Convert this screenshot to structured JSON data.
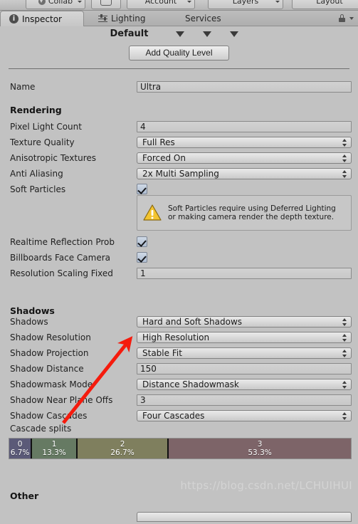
{
  "toolbar": {
    "collab_label": "Collab",
    "cloud_icon": "cloud-button-icon",
    "account_label": "Account",
    "layers_label": "Layers",
    "layout_label": "Layout"
  },
  "tabs": {
    "inspector": "Inspector",
    "lighting": "Lighting",
    "services": "Services",
    "lock_icon": "lock-icon"
  },
  "header": {
    "title": "Default",
    "dropdown_count": 3
  },
  "actions": {
    "add_quality_level": "Add Quality Level"
  },
  "name_row": {
    "label": "Name",
    "value": "Ultra"
  },
  "rendering": {
    "title": "Rendering",
    "rows": [
      {
        "label": "Pixel Light Count",
        "value": "4",
        "type": "text"
      },
      {
        "label": "Texture Quality",
        "value": "Full Res",
        "type": "popup"
      },
      {
        "label": "Anisotropic Textures",
        "value": "Forced On",
        "type": "popup"
      },
      {
        "label": "Anti Aliasing",
        "value": "2x Multi Sampling",
        "type": "popup"
      },
      {
        "label": "Soft Particles",
        "value": "checked",
        "type": "checkbox"
      }
    ],
    "warning": {
      "icon": "warning-triangle-icon",
      "text": "Soft Particles require using Deferred Lighting or making camera render the depth texture."
    },
    "rows_after_warning": [
      {
        "label": "Realtime Reflection Prob",
        "value": "checked",
        "type": "checkbox"
      },
      {
        "label": "Billboards Face Camera",
        "value": "checked",
        "type": "checkbox"
      },
      {
        "label": "Resolution Scaling Fixed",
        "value": "1",
        "type": "text"
      }
    ]
  },
  "shadows": {
    "title": "Shadows",
    "rows": [
      {
        "label": "Shadows",
        "value": "Hard and Soft Shadows",
        "type": "popup"
      },
      {
        "label": "Shadow Resolution",
        "value": "High Resolution",
        "type": "popup"
      },
      {
        "label": "Shadow Projection",
        "value": "Stable Fit",
        "type": "popup"
      },
      {
        "label": "Shadow Distance",
        "value": "150",
        "type": "text"
      },
      {
        "label": "Shadowmask Mode",
        "value": "Distance Shadowmask",
        "type": "popup"
      },
      {
        "label": "Shadow Near Plane Offs",
        "value": "3",
        "type": "text"
      },
      {
        "label": "Shadow Cascades",
        "value": "Four Cascades",
        "type": "popup"
      }
    ],
    "cascade_splits_label": "Cascade splits"
  },
  "chart_data": {
    "type": "bar",
    "title": "Cascade splits",
    "orientation": "horizontal-stacked",
    "categories": [
      "0",
      "1",
      "2",
      "3"
    ],
    "values": [
      6.7,
      13.3,
      26.7,
      53.3
    ],
    "value_labels": [
      "6.7%",
      "13.3%",
      "26.7%",
      "53.3%"
    ],
    "colors": [
      "#5b5a78",
      "#667a63",
      "#7f7f5e",
      "#7d6468"
    ],
    "xlabel": "",
    "ylabel": "",
    "ylim": [
      0,
      100
    ],
    "grid": false,
    "legend": "none"
  },
  "other": {
    "title": "Other"
  },
  "watermark": "https://blog.csdn.net/LCHUIHUI",
  "annotation": {
    "arrow_color": "#f51b0d",
    "arrow_name": "red-pointer-arrow"
  }
}
